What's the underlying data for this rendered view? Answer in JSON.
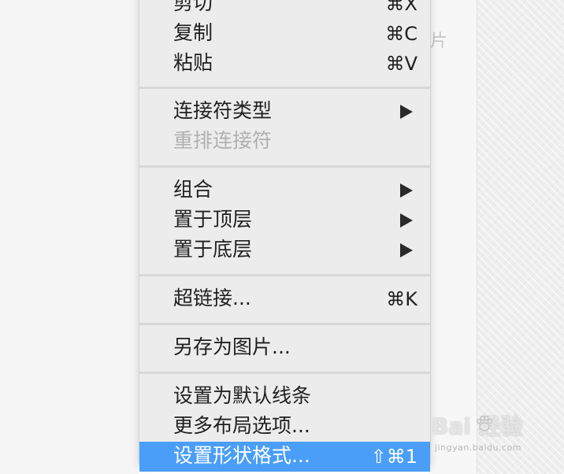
{
  "background": {
    "partial_text": "片"
  },
  "menu": {
    "items": [
      {
        "label": "剪切",
        "shortcut": "⌘X",
        "state": "normal"
      },
      {
        "label": "复制",
        "shortcut": "⌘C",
        "state": "normal"
      },
      {
        "label": "粘贴",
        "shortcut": "⌘V",
        "state": "normal"
      },
      {
        "label": "连接符类型",
        "submenu": true,
        "state": "normal"
      },
      {
        "label": "重排连接符",
        "state": "disabled"
      },
      {
        "label": "组合",
        "submenu": true,
        "state": "normal"
      },
      {
        "label": "置于顶层",
        "submenu": true,
        "state": "normal"
      },
      {
        "label": "置于底层",
        "submenu": true,
        "state": "normal"
      },
      {
        "label": "超链接...",
        "shortcut": "⌘K",
        "state": "normal"
      },
      {
        "label": "另存为图片...",
        "state": "normal"
      },
      {
        "label": "设置为默认线条",
        "state": "normal"
      },
      {
        "label": "更多布局选项...",
        "state": "normal"
      },
      {
        "label": "设置形状格式...",
        "shortcut": "⇧⌘1",
        "state": "selected"
      }
    ]
  },
  "watermark": {
    "brand": "Bai 经验",
    "url": "jingyan.baidu.com"
  },
  "colors": {
    "selection": "#4a9ef8",
    "menu_background": "#ececec",
    "disabled_text": "#b0b0b0"
  }
}
